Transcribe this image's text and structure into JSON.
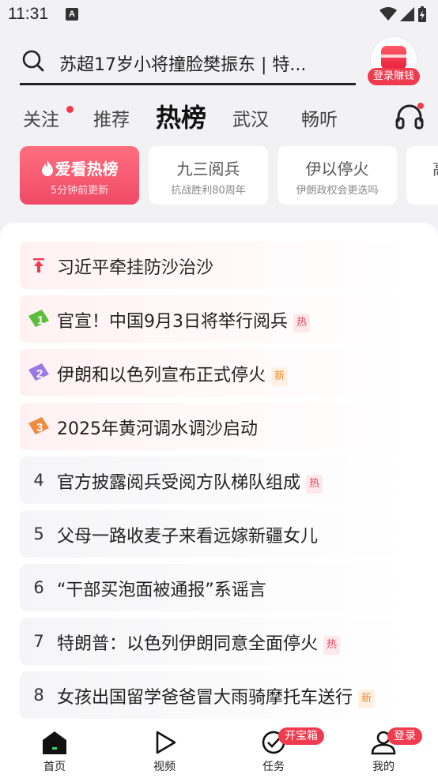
{
  "status_bar": {
    "time": "11:31",
    "app_icon_glyph": "A"
  },
  "search": {
    "text": "苏超17岁小将撞脸樊振东 | 特...",
    "login_earn_badge": "登录赚钱",
    "search_icon": "search-icon"
  },
  "tabs": [
    {
      "label": "关注",
      "has_dot": true
    },
    {
      "label": "推荐",
      "has_dot": false
    },
    {
      "label": "热榜",
      "active": true
    },
    {
      "label": "武汉",
      "has_dot": false
    },
    {
      "label": "畅听",
      "has_dot": false
    }
  ],
  "cards": [
    {
      "title": "爱看热榜",
      "sub": "5分钟前更新",
      "icon": "flame-icon"
    },
    {
      "title": "九三阅兵",
      "sub": "抗战胜利80周年"
    },
    {
      "title": "伊以停火",
      "sub": "伊朗政权会更迭吗"
    },
    {
      "title": "高",
      "sub": ""
    }
  ],
  "hot_list": [
    {
      "rank": "",
      "icon": "pin-top-icon",
      "title": "习近平牵挂防沙治沙",
      "tag": ""
    },
    {
      "rank": "1",
      "title": "官宣！中国9月3日将举行阅兵",
      "tag": "热",
      "tag_type": "hot"
    },
    {
      "rank": "2",
      "title": "伊朗和以色列宣布正式停火",
      "tag": "新",
      "tag_type": "new"
    },
    {
      "rank": "3",
      "title": "2025年黄河调水调沙启动",
      "tag": ""
    },
    {
      "rank": "4",
      "title": "官方披露阅兵受阅方队梯队组成",
      "tag": "热",
      "tag_type": "hot"
    },
    {
      "rank": "5",
      "title": "父母一路收麦子来看远嫁新疆女儿",
      "tag": ""
    },
    {
      "rank": "6",
      "title": "“干部买泡面被通报”系谣言",
      "tag": ""
    },
    {
      "rank": "7",
      "title": "特朗普：以色列伊朗同意全面停火",
      "tag": "热",
      "tag_type": "hot"
    },
    {
      "rank": "8",
      "title": "女孩出国留学爸爸冒大雨骑摩托车送行",
      "tag": "新",
      "tag_type": "new"
    }
  ],
  "bottom_nav": [
    {
      "label": "首页",
      "icon": "home-icon",
      "active": true
    },
    {
      "label": "视频",
      "icon": "play-icon"
    },
    {
      "label": "任务",
      "icon": "task-check-icon",
      "badge": "开宝箱"
    },
    {
      "label": "我的",
      "icon": "user-icon",
      "badge": "登录"
    }
  ],
  "colors": {
    "accent_red": "#f03a4e",
    "hot_card_gradient_top": "#ff6f7f",
    "hot_card_gradient_bottom": "#f04a66",
    "rank1": "#5cbf3a",
    "rank2": "#9a7ae0",
    "rank3": "#f08a3c",
    "pin": "#f03a4e"
  }
}
